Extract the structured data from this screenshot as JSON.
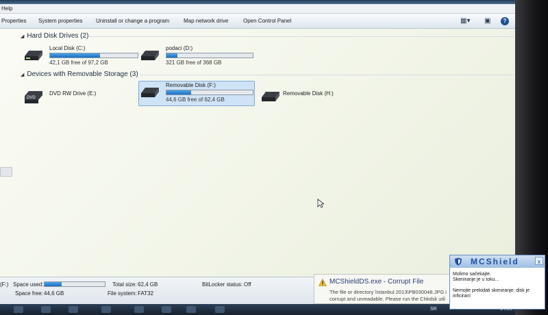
{
  "menu": {
    "help": "Help"
  },
  "toolbar": {
    "properties": "Properties",
    "system_properties": "System properties",
    "uninstall": "Uninstall or change a program",
    "map_drive": "Map network drive",
    "control_panel": "Open Control Panel",
    "view_icon": "view-options-icon",
    "pane_icon": "preview-pane-icon",
    "help_icon": "help-icon"
  },
  "groups": {
    "hard_disks": {
      "label": "Hard Disk Drives (2)",
      "drives": [
        {
          "name": "Local Disk (C:)",
          "free": "42,1 GB free of 97,2 GB",
          "used_fraction": 0.567
        },
        {
          "name": "podaci (D:)",
          "free": "321 GB free of 368 GB",
          "used_fraction": 0.128
        }
      ]
    },
    "removable": {
      "label": "Devices with Removable Storage (3)",
      "drives": [
        {
          "name": "DVD RW Drive (E:)",
          "badge": "DVD"
        },
        {
          "name": "Removable Disk (F:)",
          "free": "44,6 GB free of 62,4 GB",
          "used_fraction": 0.285
        },
        {
          "name": "Removable Disk (H:)"
        }
      ]
    }
  },
  "details": {
    "drive_label": "(F:)",
    "space_used_label": "Space used:",
    "space_used_fraction": 0.285,
    "space_free_label": "Space free:",
    "space_free_value": "44,6 GB",
    "total_size_label": "Total size:",
    "total_size_value": "62,4 GB",
    "fs_label": "File system:",
    "fs_value": "FAT32",
    "bitlocker_label": "BitLocker status:",
    "bitlocker_value": "Off"
  },
  "balloon": {
    "title": "MCShieldDS.exe - Corrupt File",
    "message": "The file or directory \\Istanbul 2013\\PB030048.JPG i corrupt and unreadable. Please run the Chkdsk util"
  },
  "mcshield": {
    "title": "MCShield",
    "close": "x",
    "line1": "Molimo sačekajte.",
    "line2": "Skeniranje je u toku...",
    "line3": "Nemojte prekidati skeniranje: disk je",
    "line4": "inficiran!"
  },
  "taskbar": {
    "lang": "SR",
    "clock": "14:56"
  },
  "colors": {
    "bar_fill": "#1d6fc0",
    "accent": "#1e4fa0"
  }
}
